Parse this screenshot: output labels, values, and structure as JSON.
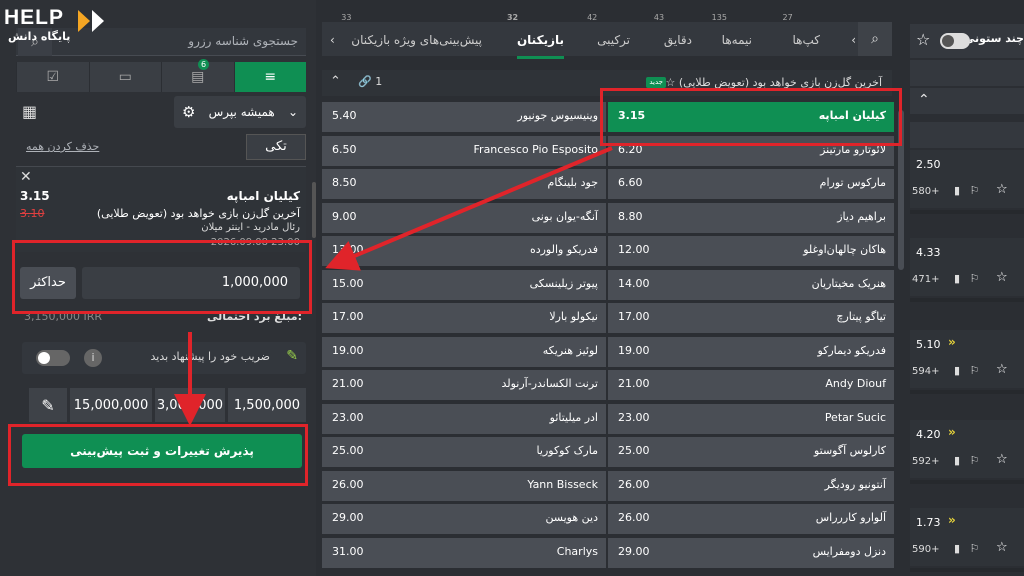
{
  "logo": {
    "text": "HELP",
    "subtitle": "پایگاه دانش"
  },
  "left": {
    "search_placeholder": "جستجوی شناسه رزرو",
    "tabs": [
      {
        "name": "betslip-tab",
        "icon": "≡",
        "badge": ""
      },
      {
        "name": "bets-tab",
        "icon": "▤",
        "badge": "6"
      },
      {
        "name": "id-tab",
        "icon": "▭",
        "badge": ""
      },
      {
        "name": "check-tab",
        "icon": "☑",
        "badge": ""
      }
    ],
    "pref_label": "همیشه بپرس",
    "single_label": "تکی",
    "delete_all": "حذف کردن همه",
    "selection": {
      "name": "کیلیان امباپه",
      "odd": "3.15",
      "old_odd": "3.10",
      "market": "آخرین گل‌زن بازی خواهد بود (تعویض طلایی)",
      "match": "رئال مادرید - اینتر میلان",
      "date": "2026.09.08 23:00"
    },
    "max_label": "حداکثر",
    "stake_value": "1,000,000",
    "potential_label": "مبلغ برد احتمالی:",
    "potential_value": "3,150,000 IRR",
    "suggest_label": "ضریب خود را پیشنهاد بدید",
    "quick_stakes": [
      "1,500,000",
      "3,000,000",
      "15,000,000"
    ],
    "accept_label": "پذیرش تغییرات و ثبت پیش‌بینی"
  },
  "mid": {
    "tabs": [
      {
        "label": "پیش‌بینی‌های ویژه بازیکنان",
        "count": "33"
      },
      {
        "label": "بازیکنان",
        "count": "32",
        "active": true
      },
      {
        "label": "ترکیبی",
        "count": "42"
      },
      {
        "label": "دقایق",
        "count": "43"
      },
      {
        "label": "نیمه‌ها",
        "count": "135"
      },
      {
        "label": "کپ‌ها",
        "count": "27"
      }
    ],
    "market_title": "آخرین گل‌زن بازی خواهد بود (تعویض طلایی)",
    "new_badge": "جدید",
    "link_count": "1",
    "rows": [
      {
        "a": "کیلیان امباپه",
        "ao": "3.15",
        "b": "وینیسیوس جونیور",
        "bo": "5.40"
      },
      {
        "a": "لائوتارو مارتینز",
        "ao": "6.20",
        "b": "Francesco Pio Esposito",
        "bo": "6.50"
      },
      {
        "a": "مارکوس تورام",
        "ao": "6.60",
        "b": "جود بلینگام",
        "bo": "8.50"
      },
      {
        "a": "براهیم دیاز",
        "ao": "8.80",
        "b": "آنگه-یوان بونی",
        "bo": "9.00"
      },
      {
        "a": "هاکان چالهان‌اوغلو",
        "ao": "12.00",
        "b": "فدریکو والورده",
        "bo": "13.00"
      },
      {
        "a": "هنریک مخیتاریان",
        "ao": "14.00",
        "b": "پیوتر زیلینسکی",
        "bo": "15.00"
      },
      {
        "a": "تیاگو پیتارچ",
        "ao": "17.00",
        "b": "نیکولو بارلا",
        "bo": "17.00"
      },
      {
        "a": "فدریکو دیمارکو",
        "ao": "19.00",
        "b": "لوئیز هنریکه",
        "bo": "19.00"
      },
      {
        "a": "Andy Diouf",
        "ao": "21.00",
        "b": "ترنت الکساندر-آرنولد",
        "bo": "21.00"
      },
      {
        "a": "Petar Sucic",
        "ao": "23.00",
        "b": "ادر میلیتائو",
        "bo": "23.00"
      },
      {
        "a": "کارلوس آگوستو",
        "ao": "25.00",
        "b": "مارک کوکوریا",
        "bo": "25.00"
      },
      {
        "a": "آنتونیو رودیگر",
        "ao": "26.00",
        "b": "Yann Bisseck",
        "bo": "26.00"
      },
      {
        "a": "آلوارو کاررراس",
        "ao": "26.00",
        "b": "دین هویسن",
        "bo": "29.00"
      },
      {
        "a": "دنزل دومفرایس",
        "ao": "29.00",
        "b": "Charlys",
        "bo": "31.00"
      }
    ]
  },
  "right": {
    "columns_label": "چند ستونی",
    "cards": [
      {
        "odd": "2.50",
        "count": "580+"
      },
      {
        "odd": "4.33",
        "count": "471+"
      },
      {
        "odd": "5.10",
        "count": "594+"
      },
      {
        "odd": "4.20",
        "count": "592+"
      },
      {
        "odd": "1.73",
        "count": "590+"
      }
    ]
  }
}
